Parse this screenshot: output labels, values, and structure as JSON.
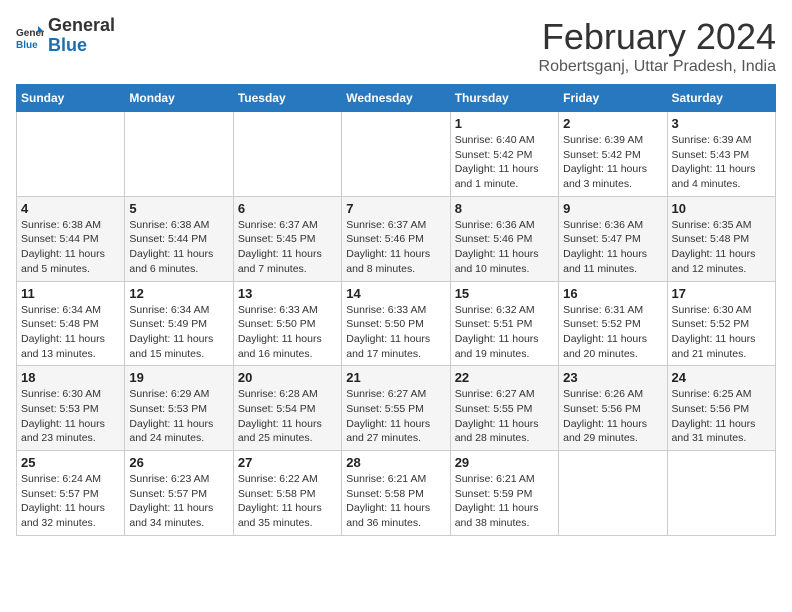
{
  "logo": {
    "text_general": "General",
    "text_blue": "Blue"
  },
  "title": "February 2024",
  "location": "Robertsganj, Uttar Pradesh, India",
  "days_of_week": [
    "Sunday",
    "Monday",
    "Tuesday",
    "Wednesday",
    "Thursday",
    "Friday",
    "Saturday"
  ],
  "weeks": [
    [
      {
        "day": "",
        "info": ""
      },
      {
        "day": "",
        "info": ""
      },
      {
        "day": "",
        "info": ""
      },
      {
        "day": "",
        "info": ""
      },
      {
        "day": "1",
        "info": "Sunrise: 6:40 AM\nSunset: 5:42 PM\nDaylight: 11 hours and 1 minute."
      },
      {
        "day": "2",
        "info": "Sunrise: 6:39 AM\nSunset: 5:42 PM\nDaylight: 11 hours and 3 minutes."
      },
      {
        "day": "3",
        "info": "Sunrise: 6:39 AM\nSunset: 5:43 PM\nDaylight: 11 hours and 4 minutes."
      }
    ],
    [
      {
        "day": "4",
        "info": "Sunrise: 6:38 AM\nSunset: 5:44 PM\nDaylight: 11 hours and 5 minutes."
      },
      {
        "day": "5",
        "info": "Sunrise: 6:38 AM\nSunset: 5:44 PM\nDaylight: 11 hours and 6 minutes."
      },
      {
        "day": "6",
        "info": "Sunrise: 6:37 AM\nSunset: 5:45 PM\nDaylight: 11 hours and 7 minutes."
      },
      {
        "day": "7",
        "info": "Sunrise: 6:37 AM\nSunset: 5:46 PM\nDaylight: 11 hours and 8 minutes."
      },
      {
        "day": "8",
        "info": "Sunrise: 6:36 AM\nSunset: 5:46 PM\nDaylight: 11 hours and 10 minutes."
      },
      {
        "day": "9",
        "info": "Sunrise: 6:36 AM\nSunset: 5:47 PM\nDaylight: 11 hours and 11 minutes."
      },
      {
        "day": "10",
        "info": "Sunrise: 6:35 AM\nSunset: 5:48 PM\nDaylight: 11 hours and 12 minutes."
      }
    ],
    [
      {
        "day": "11",
        "info": "Sunrise: 6:34 AM\nSunset: 5:48 PM\nDaylight: 11 hours and 13 minutes."
      },
      {
        "day": "12",
        "info": "Sunrise: 6:34 AM\nSunset: 5:49 PM\nDaylight: 11 hours and 15 minutes."
      },
      {
        "day": "13",
        "info": "Sunrise: 6:33 AM\nSunset: 5:50 PM\nDaylight: 11 hours and 16 minutes."
      },
      {
        "day": "14",
        "info": "Sunrise: 6:33 AM\nSunset: 5:50 PM\nDaylight: 11 hours and 17 minutes."
      },
      {
        "day": "15",
        "info": "Sunrise: 6:32 AM\nSunset: 5:51 PM\nDaylight: 11 hours and 19 minutes."
      },
      {
        "day": "16",
        "info": "Sunrise: 6:31 AM\nSunset: 5:52 PM\nDaylight: 11 hours and 20 minutes."
      },
      {
        "day": "17",
        "info": "Sunrise: 6:30 AM\nSunset: 5:52 PM\nDaylight: 11 hours and 21 minutes."
      }
    ],
    [
      {
        "day": "18",
        "info": "Sunrise: 6:30 AM\nSunset: 5:53 PM\nDaylight: 11 hours and 23 minutes."
      },
      {
        "day": "19",
        "info": "Sunrise: 6:29 AM\nSunset: 5:53 PM\nDaylight: 11 hours and 24 minutes."
      },
      {
        "day": "20",
        "info": "Sunrise: 6:28 AM\nSunset: 5:54 PM\nDaylight: 11 hours and 25 minutes."
      },
      {
        "day": "21",
        "info": "Sunrise: 6:27 AM\nSunset: 5:55 PM\nDaylight: 11 hours and 27 minutes."
      },
      {
        "day": "22",
        "info": "Sunrise: 6:27 AM\nSunset: 5:55 PM\nDaylight: 11 hours and 28 minutes."
      },
      {
        "day": "23",
        "info": "Sunrise: 6:26 AM\nSunset: 5:56 PM\nDaylight: 11 hours and 29 minutes."
      },
      {
        "day": "24",
        "info": "Sunrise: 6:25 AM\nSunset: 5:56 PM\nDaylight: 11 hours and 31 minutes."
      }
    ],
    [
      {
        "day": "25",
        "info": "Sunrise: 6:24 AM\nSunset: 5:57 PM\nDaylight: 11 hours and 32 minutes."
      },
      {
        "day": "26",
        "info": "Sunrise: 6:23 AM\nSunset: 5:57 PM\nDaylight: 11 hours and 34 minutes."
      },
      {
        "day": "27",
        "info": "Sunrise: 6:22 AM\nSunset: 5:58 PM\nDaylight: 11 hours and 35 minutes."
      },
      {
        "day": "28",
        "info": "Sunrise: 6:21 AM\nSunset: 5:58 PM\nDaylight: 11 hours and 36 minutes."
      },
      {
        "day": "29",
        "info": "Sunrise: 6:21 AM\nSunset: 5:59 PM\nDaylight: 11 hours and 38 minutes."
      },
      {
        "day": "",
        "info": ""
      },
      {
        "day": "",
        "info": ""
      }
    ]
  ]
}
